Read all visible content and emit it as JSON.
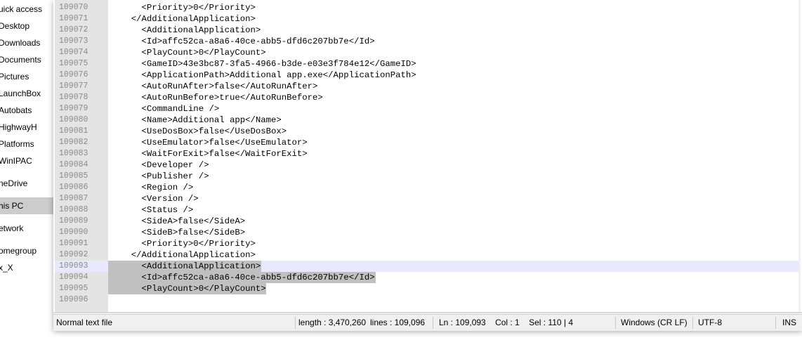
{
  "nav_pane": {
    "items": [
      {
        "label": "uick access",
        "top": 0
      },
      {
        "label": "Desktop"
      },
      {
        "label": "Downloads"
      },
      {
        "label": "Documents"
      },
      {
        "label": "Pictures"
      },
      {
        "label": "LaunchBox"
      },
      {
        "label": "Autobats"
      },
      {
        "label": "HighwayH"
      },
      {
        "label": "Platforms"
      },
      {
        "label": "WinIPAC"
      },
      {
        "label": "neDrive"
      },
      {
        "label": "his PC"
      },
      {
        "label": "etwork"
      },
      {
        "label": "omegroup"
      },
      {
        "label": "x_X"
      }
    ]
  },
  "editor": {
    "lines": [
      {
        "num": "109070",
        "text": "    <Priority>0</Priority>"
      },
      {
        "num": "109071",
        "text": "  </AdditionalApplication>"
      },
      {
        "num": "109072",
        "text": "    <AdditionalApplication>"
      },
      {
        "num": "109073",
        "text": "    <Id>affc52ca-a8a6-40ce-abb5-dfd6c207bb7e</Id>"
      },
      {
        "num": "109074",
        "text": "    <PlayCount>0</PlayCount>"
      },
      {
        "num": "109075",
        "text": "    <GameID>43e3bc87-3fa5-4966-b3de-e03e3f784e12</GameID>"
      },
      {
        "num": "109076",
        "text": "    <ApplicationPath>Additional app.exe</ApplicationPath>"
      },
      {
        "num": "109077",
        "text": "    <AutoRunAfter>false</AutoRunAfter>"
      },
      {
        "num": "109078",
        "text": "    <AutoRunBefore>true</AutoRunBefore>"
      },
      {
        "num": "109079",
        "text": "    <CommandLine />"
      },
      {
        "num": "109080",
        "text": "    <Name>Additional app</Name>"
      },
      {
        "num": "109081",
        "text": "    <UseDosBox>false</UseDosBox>"
      },
      {
        "num": "109082",
        "text": "    <UseEmulator>false</UseEmulator>"
      },
      {
        "num": "109083",
        "text": "    <WaitForExit>false</WaitForExit>"
      },
      {
        "num": "109084",
        "text": "    <Developer />"
      },
      {
        "num": "109085",
        "text": "    <Publisher />"
      },
      {
        "num": "109086",
        "text": "    <Region />"
      },
      {
        "num": "109087",
        "text": "    <Version />"
      },
      {
        "num": "109088",
        "text": "    <Status />"
      },
      {
        "num": "109089",
        "text": "    <SideA>false</SideA>"
      },
      {
        "num": "109090",
        "text": "    <SideB>false</SideB>"
      },
      {
        "num": "109091",
        "text": "    <Priority>0</Priority>"
      },
      {
        "num": "109092",
        "text": "  </AdditionalApplication>"
      },
      {
        "num": "109093",
        "text": "    <AdditionalApplication>"
      },
      {
        "num": "109094",
        "text": "    <Id>affc52ca-a8a6-40ce-abb5-dfd6c207bb7e</Id>"
      },
      {
        "num": "109095",
        "text": "    <PlayCount>0</PlayCount>"
      },
      {
        "num": "109096",
        "text": ""
      }
    ]
  },
  "statusbar": {
    "file_type": "Normal text file",
    "length": "length : 3,470,260",
    "lines": "lines : 109,096",
    "position": "Ln : 109,093    Col : 1    Sel : 110 | 4",
    "eol": "Windows (CR LF)",
    "encoding": "UTF-8",
    "mode": "INS"
  },
  "colors": {
    "selection": "#c0c0c0",
    "current_line": "#e8e8ff",
    "gutter": "#e4e4e4"
  }
}
